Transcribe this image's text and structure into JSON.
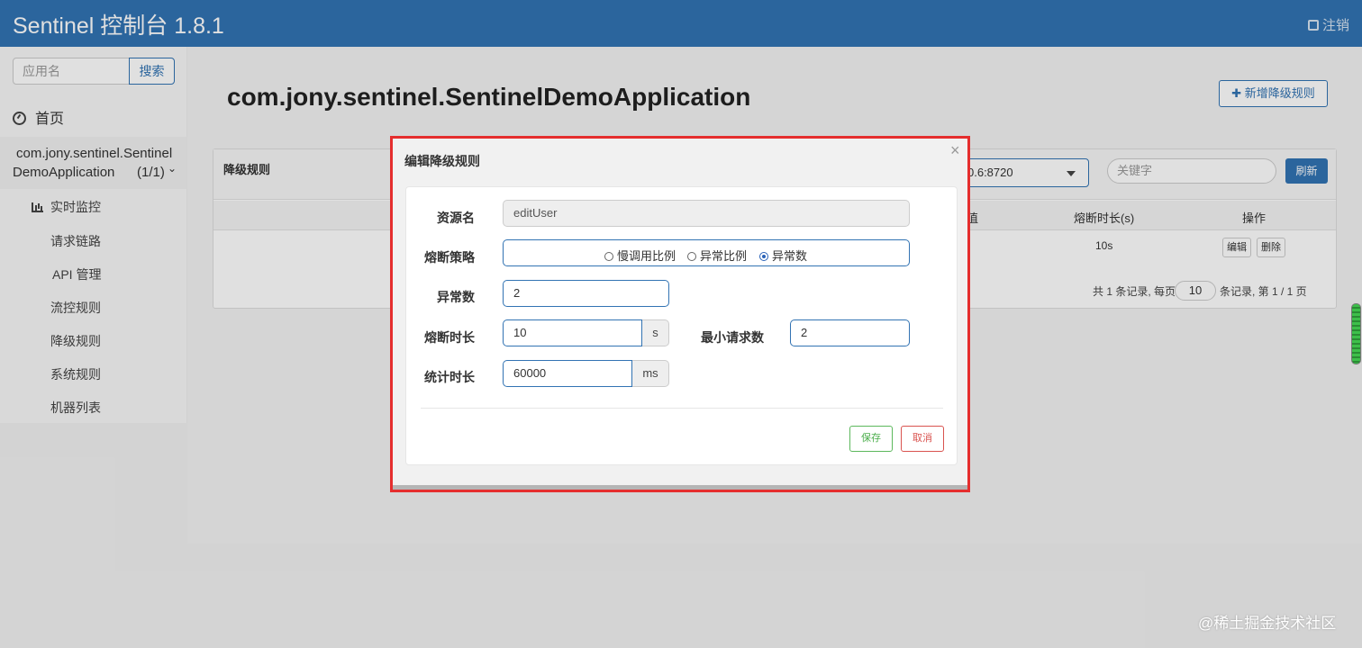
{
  "header": {
    "brand": "Sentinel 控制台 1.8.1",
    "logout": "注销"
  },
  "sidebar": {
    "search_placeholder": "应用名",
    "search_button": "搜索",
    "home": "首页",
    "app": {
      "name_line1": "com.jony.sentinel.Sentinel",
      "name_line2": "DemoApplication",
      "count": "(1/1)"
    },
    "items": [
      {
        "label": "实时监控"
      },
      {
        "label": "请求链路"
      },
      {
        "label": "API 管理"
      },
      {
        "label": "流控规则"
      },
      {
        "label": "降级规则"
      },
      {
        "label": "系统规则"
      },
      {
        "label": "机器列表"
      }
    ]
  },
  "main": {
    "page_title": "com.jony.sentinel.SentinelDemoApplication",
    "add_button": "新增降级规则",
    "panel_title": "降级规则",
    "machine_select": "0.6:8720",
    "keyword_placeholder": "关键字",
    "refresh_button": "刷新",
    "columns": [
      "值",
      "熔断时长(s)",
      "操作"
    ],
    "row": {
      "duration": "10s",
      "edit": "编辑",
      "delete": "删除"
    },
    "pager": {
      "prefix": "共 1 条记录, 每页",
      "page_size": "10",
      "suffix": "条记录, 第 1 / 1 页"
    }
  },
  "modal": {
    "title": "编辑降级规则",
    "close": "×",
    "resource_label": "资源名",
    "resource_value": "editUser",
    "strategy_label": "熔断策略",
    "strategy_options": [
      {
        "label": "慢调用比例",
        "checked": false
      },
      {
        "label": "异常比例",
        "checked": false
      },
      {
        "label": "异常数",
        "checked": true
      }
    ],
    "exception_count_label": "异常数",
    "exception_count_value": "2",
    "duration_label": "熔断时长",
    "duration_value": "10",
    "duration_unit": "s",
    "min_request_label": "最小请求数",
    "min_request_value": "2",
    "stat_label": "统计时长",
    "stat_value": "60000",
    "stat_unit": "ms",
    "save_button": "保存",
    "cancel_button": "取消"
  },
  "watermark": "@稀土掘金技术社区",
  "colors": {
    "header": "#3273b3",
    "highlight_frame": "#e52e2e",
    "save": "#5cb85c",
    "cancel": "#d9534f"
  }
}
